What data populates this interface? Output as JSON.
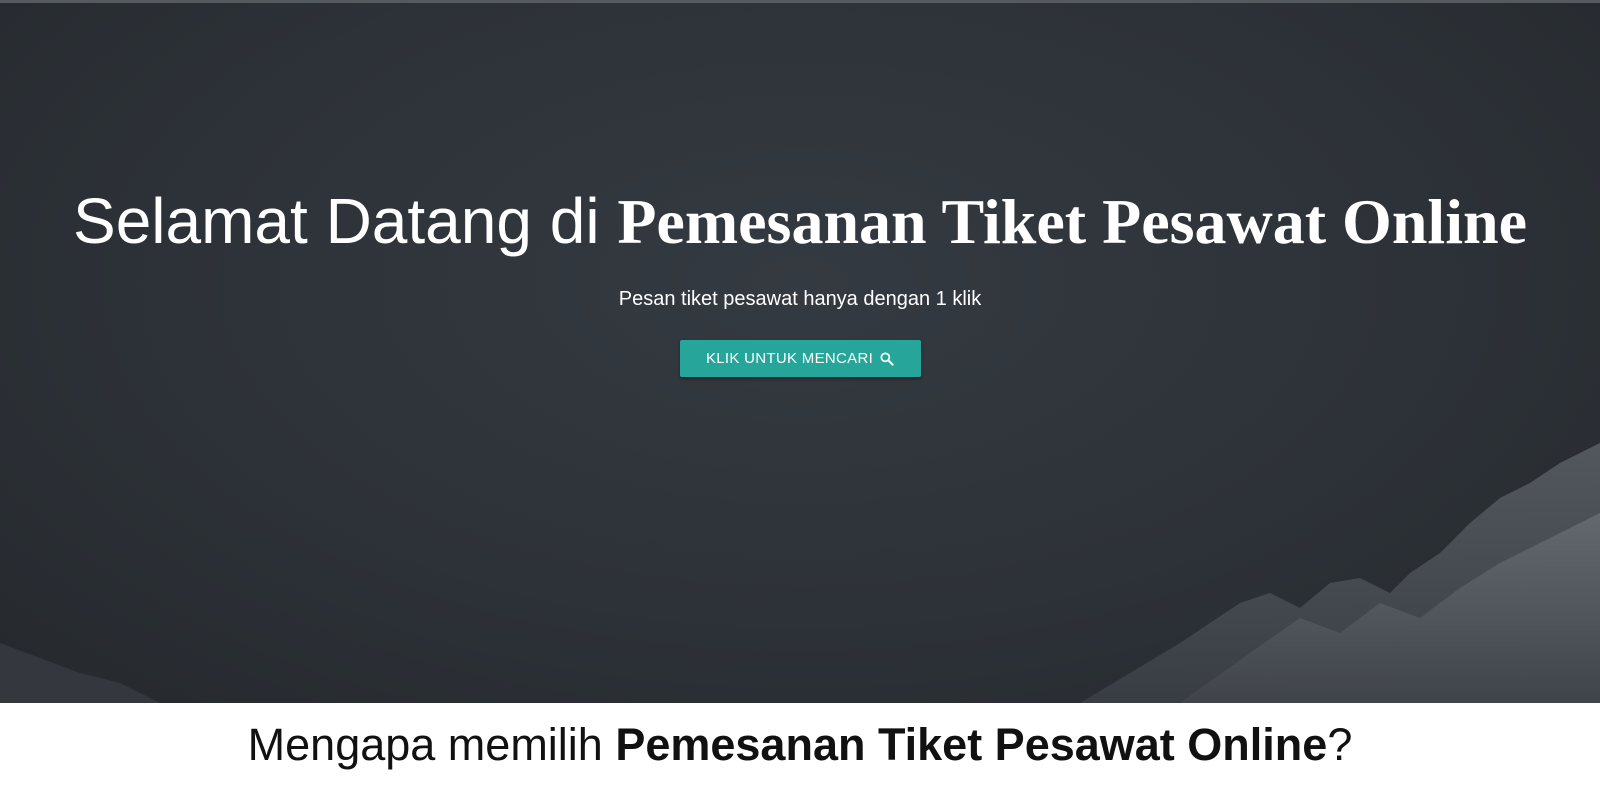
{
  "hero": {
    "title_prefix": "Selamat Datang di ",
    "title_brand": "Pemesanan Tiket Pesawat Online",
    "subtitle": "Pesan tiket pesawat hanya dengan 1 klik",
    "button_label": "KLIK UNTUK MENCARI",
    "button_icon": "search-icon",
    "button_color": "#26a69a"
  },
  "why": {
    "prefix": "Mengapa memilih ",
    "brand": "Pemesanan Tiket Pesawat Online",
    "suffix": "?"
  }
}
